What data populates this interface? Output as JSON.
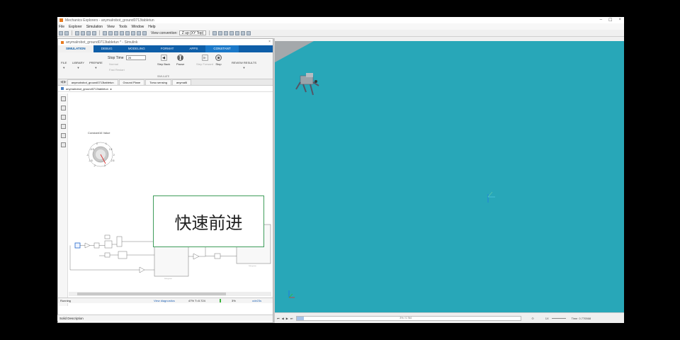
{
  "window": {
    "title": "Mechanics Explorers - anymalrobot_ground0713tabletun",
    "controls": [
      "–",
      "☐",
      "×"
    ]
  },
  "menu": [
    "File",
    "Explorer",
    "Simulation",
    "View",
    "Tools",
    "Window",
    "Help"
  ],
  "toolbar": {
    "view_convention_label": "View convention:",
    "view_convention_value": "Z up (XY Top)"
  },
  "simulink": {
    "title": "anymalrobot_ground0713tabletun * - Simulink",
    "ribbon_tabs": [
      "SIMULATION",
      "DEBUG",
      "MODELING",
      "FORMAT",
      "APPS",
      "CONSTANT"
    ],
    "ribbon": {
      "file": "FILE",
      "library": "LIBRARY",
      "prepare": "PREPARE",
      "stop_time_label": "Stop Time",
      "stop_time_value": "20",
      "normal": "Normal",
      "fast_restart": "Fast Restart",
      "step_back": "Step Back",
      "pause": "Pause",
      "step_forward": "Step Forward",
      "stop": "Stop",
      "review_results": "REVIEW RESULTS",
      "simulate_group": "SIMULATE"
    },
    "doc_tabs": [
      "anymalrobot_ground0713tabletun",
      "Ground Plane",
      "Torso sensing",
      "anymal6"
    ],
    "breadcrumb": "anymalrobot_ground0713tabletun",
    "knob_label": "Constant16 Value",
    "annotation_text": "快速前进",
    "status": {
      "state": "Running",
      "diagnostics": "View diagnostics",
      "progress_text": "47%  T=0.724",
      "progress": 0.47,
      "pct2": "3%",
      "solver": "ode23s"
    }
  },
  "solid_description": "Solid Description",
  "mechanics": {
    "playback_time_label": "Time",
    "playback_time": "0.770568",
    "speed": "1X",
    "playback_progress": "3% / 0.764",
    "floor_color": "#28a7b8"
  }
}
